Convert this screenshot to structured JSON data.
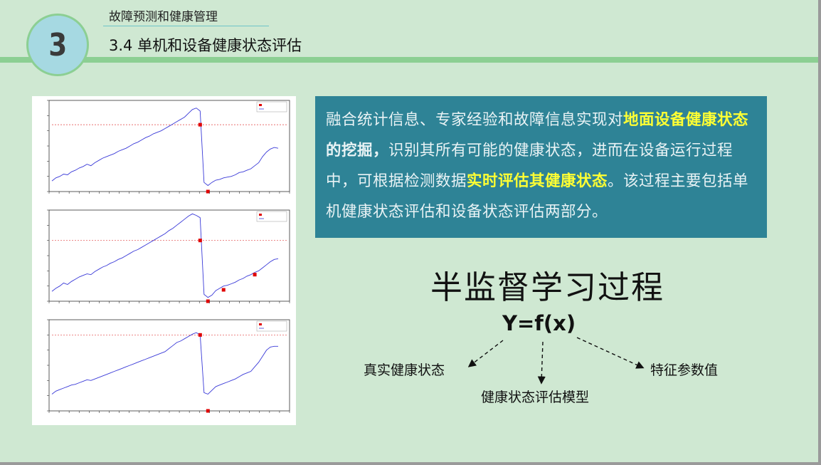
{
  "header": {
    "badge_number": "3",
    "section": "故障预测和健康管理",
    "title": "3.4 单机和设备健康状态评估"
  },
  "text_box": {
    "segments": [
      {
        "text": "融合统计信息、专家经验和故障信息实现对",
        "highlight": false
      },
      {
        "text": "地面设备健康状态",
        "highlight": true
      },
      {
        "text": "的挖掘，",
        "highlight": false,
        "bold": true
      },
      {
        "text": "识别其所有可能的健康状态，进而在设备运行过程中，可根据检测数据",
        "highlight": false
      },
      {
        "text": "实时评估其健康状态",
        "highlight": true
      },
      {
        "text": "。该过程主要包括单机健康状态评估和设备状态评估两部分。",
        "highlight": false
      }
    ]
  },
  "diagram": {
    "title": "半监督学习过程",
    "formula": "Y=f(x)",
    "labels": {
      "true_state": "真实健康状态",
      "model": "健康状态评估模型",
      "feature": "特征参数值"
    }
  },
  "colors": {
    "background": "#cfe8d2",
    "accent_green": "#8ccf93",
    "text_box_bg": "#2e8396",
    "highlight": "#ffff33",
    "series_line": "#3a3ad8",
    "threshold": "#e04040",
    "marker": "#e00000"
  },
  "charts": [
    {
      "series": [
        14,
        18,
        20,
        23,
        22,
        26,
        28,
        31,
        33,
        36,
        34,
        38,
        41,
        44,
        46,
        48,
        50,
        53,
        55,
        57,
        60,
        63,
        65,
        68,
        71,
        73,
        76,
        78,
        80,
        83,
        86,
        89,
        92,
        95,
        98,
        103,
        108,
        110,
        106,
        12,
        8,
        12,
        15,
        16,
        18,
        19,
        20,
        22,
        25,
        26,
        28,
        30,
        34,
        38,
        46,
        52,
        56,
        58,
        57
      ],
      "threshold": 88,
      "markers": [
        {
          "i": 38,
          "v": 88
        },
        {
          "i": 40,
          "v": 0
        }
      ]
    },
    {
      "series": [
        13,
        17,
        20,
        24,
        22,
        26,
        29,
        32,
        34,
        36,
        35,
        39,
        42,
        45,
        47,
        50,
        52,
        55,
        57,
        60,
        63,
        66,
        68,
        71,
        74,
        77,
        80,
        83,
        86,
        89,
        93,
        96,
        100,
        104,
        108,
        112,
        115,
        113,
        110,
        9,
        5,
        8,
        14,
        17,
        20,
        21,
        23,
        25,
        28,
        30,
        33,
        35,
        38,
        40,
        44,
        48,
        52,
        55,
        56
      ],
      "threshold": 80,
      "markers": [
        {
          "i": 38,
          "v": 80
        },
        {
          "i": 40,
          "v": 0
        },
        {
          "i": 44,
          "v": 15
        },
        {
          "i": 52,
          "v": 35
        }
      ]
    },
    {
      "series": [
        22,
        26,
        28,
        30,
        32,
        34,
        35,
        37,
        39,
        41,
        40,
        42,
        44,
        46,
        48,
        50,
        52,
        54,
        56,
        58,
        60,
        62,
        64,
        66,
        68,
        70,
        72,
        74,
        76,
        78,
        82,
        86,
        90,
        92,
        95,
        98,
        101,
        103,
        100,
        24,
        22,
        27,
        32,
        34,
        36,
        38,
        40,
        42,
        45,
        48,
        50,
        52,
        58,
        64,
        72,
        80,
        84,
        85,
        85
      ],
      "threshold": 100,
      "markers": [
        {
          "i": 38,
          "v": 100
        },
        {
          "i": 40,
          "v": 0
        }
      ]
    }
  ]
}
